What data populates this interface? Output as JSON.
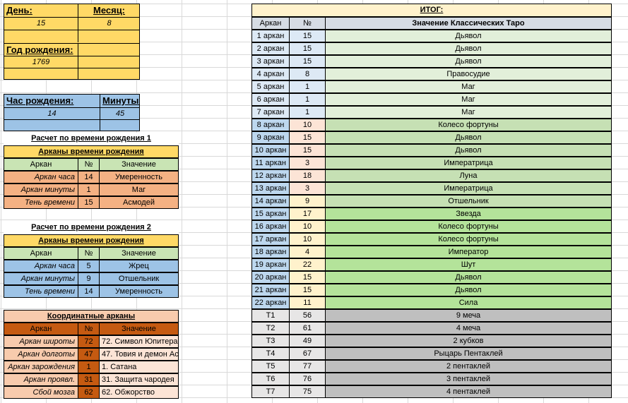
{
  "birth": {
    "day_label": "День:",
    "month_label": "Месяц:",
    "day": "15",
    "month": "8",
    "year_label": "Год рождения:",
    "year": "1769",
    "hour_label": "Час рождения:",
    "minute_label": "Минуты:",
    "hour": "14",
    "minute": "45"
  },
  "calc1": {
    "title": "Расчет по времени рождения 1",
    "header": "Арканы времени рождения",
    "cols": [
      "Аркан",
      "№",
      "Значение"
    ],
    "rows": [
      {
        "name": "Аркан часа",
        "num": "14",
        "value": "Умеренность"
      },
      {
        "name": "Аркан минуты",
        "num": "1",
        "value": "Маг"
      },
      {
        "name": "Тень времени",
        "num": "15",
        "value": "Асмодей"
      }
    ]
  },
  "calc2": {
    "title": "Расчет по времени рождения 2",
    "header": "Арканы времени рождения",
    "cols": [
      "Аркан",
      "№",
      "Значение"
    ],
    "rows": [
      {
        "name": "Аркан часа",
        "num": "5",
        "value": "Жрец"
      },
      {
        "name": "Аркан минуты",
        "num": "9",
        "value": "Отшельник"
      },
      {
        "name": "Тень времени",
        "num": "14",
        "value": "Умеренность"
      }
    ]
  },
  "coords": {
    "header": "Координатные арканы",
    "cols": [
      "Аркан",
      "№",
      "Значение"
    ],
    "rows": [
      {
        "name": "Аркан широты",
        "num": "72",
        "value": "72. Символ Юпитера"
      },
      {
        "name": "Аркан долготы",
        "num": "47",
        "value": "47. Товия и демон Ас"
      },
      {
        "name": "Аркан зарождения",
        "num": "1",
        "value": "1. Сатана"
      },
      {
        "name": "Аркан проявл.",
        "num": "31",
        "value": "31. Защита чародея"
      },
      {
        "name": "Сбой мозга",
        "num": "62",
        "value": "62. Обжорство"
      }
    ]
  },
  "itog": {
    "title": "ИТОГ:",
    "cols": [
      "Аркан",
      "№",
      "Значение Классических Таро"
    ],
    "rows": [
      {
        "a": "1 аркан",
        "n": "15",
        "v": "Дьявол"
      },
      {
        "a": "2 аркан",
        "n": "15",
        "v": "Дьявол"
      },
      {
        "a": "3 аркан",
        "n": "15",
        "v": "Дьявол"
      },
      {
        "a": "4 аркан",
        "n": "8",
        "v": "Правосудие"
      },
      {
        "a": "5 аркан",
        "n": "1",
        "v": "Маг"
      },
      {
        "a": "6 аркан",
        "n": "1",
        "v": "Маг"
      },
      {
        "a": "7 аркан",
        "n": "1",
        "v": "Маг"
      },
      {
        "a": "8 аркан",
        "n": "10",
        "v": "Колесо фортуны"
      },
      {
        "a": "9 аркан",
        "n": "15",
        "v": "Дьявол"
      },
      {
        "a": "10 аркан",
        "n": "15",
        "v": "Дьявол"
      },
      {
        "a": "11 аркан",
        "n": "3",
        "v": "Императрица"
      },
      {
        "a": "12 аркан",
        "n": "18",
        "v": "Луна"
      },
      {
        "a": "13 аркан",
        "n": "3",
        "v": "Императрица"
      },
      {
        "a": "14 аркан",
        "n": "9",
        "v": "Отшельник"
      },
      {
        "a": "15 аркан",
        "n": "17",
        "v": "Звезда"
      },
      {
        "a": "16 аркан",
        "n": "10",
        "v": "Колесо фортуны"
      },
      {
        "a": "17 аркан",
        "n": "10",
        "v": "Колесо фортуны"
      },
      {
        "a": "18 аркан",
        "n": "4",
        "v": "Император"
      },
      {
        "a": "19 аркан",
        "n": "22",
        "v": "Шут"
      },
      {
        "a": "20 аркан",
        "n": "15",
        "v": "Дьявол"
      },
      {
        "a": "21 аркан",
        "n": "15",
        "v": "Дьявол"
      },
      {
        "a": "22 аркан",
        "n": "11",
        "v": "Сила"
      },
      {
        "a": "Т1",
        "n": "56",
        "v": "9 меча"
      },
      {
        "a": "Т2",
        "n": "61",
        "v": "4 меча"
      },
      {
        "a": "Т3",
        "n": "49",
        "v": "2 кубков"
      },
      {
        "a": "Т4",
        "n": "67",
        "v": "Рыцарь Пентаклей"
      },
      {
        "a": "Т5",
        "n": "77",
        "v": "2 пентаклей"
      },
      {
        "a": "Т6",
        "n": "76",
        "v": "3 пентаклей"
      },
      {
        "a": "Т7",
        "n": "75",
        "v": "4 пентаклей"
      }
    ]
  },
  "colors": {
    "date_block": "#ffd966",
    "time_block": "#9dc3e6",
    "header_green": "#c9e4b4",
    "salmon": "#f4b183",
    "brown": "#c55a11",
    "gray": "#bfbfbf"
  }
}
